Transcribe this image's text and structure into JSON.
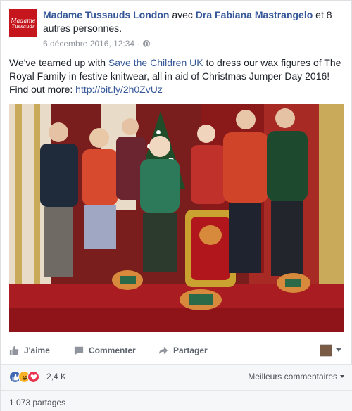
{
  "header": {
    "page_name": "Madame Tussauds London",
    "with_text": " avec ",
    "tagged_name": "Dra Fabiana Mastrangelo",
    "and_text": " et ",
    "others": "8 autres personnes",
    "period": ".",
    "timestamp": "6 décembre 2016, 12:34",
    "separator": "·",
    "logo_line1": "Madame",
    "logo_line2": "Tussauds"
  },
  "post": {
    "text_before": "We've teamed up with ",
    "link_text": "Save the Children UK",
    "text_middle": " to dress our wax figures of The Royal Family in festive knitwear, all in aid of Christmas Jumper Day 2016! Find out more: ",
    "url": "http://bit.ly/2h0ZvUz"
  },
  "actions": {
    "like": "J'aime",
    "comment": "Commenter",
    "share": "Partager"
  },
  "reactions": {
    "count": "2,4 K",
    "types": [
      "like-icon",
      "haha-icon",
      "love-icon"
    ],
    "sort_label": "Meilleurs commentaires"
  },
  "shares": {
    "label": "1 073 partages"
  },
  "colors": {
    "link": "#365899",
    "brand_red": "#c4161c",
    "like_blue": "#4267b2"
  }
}
